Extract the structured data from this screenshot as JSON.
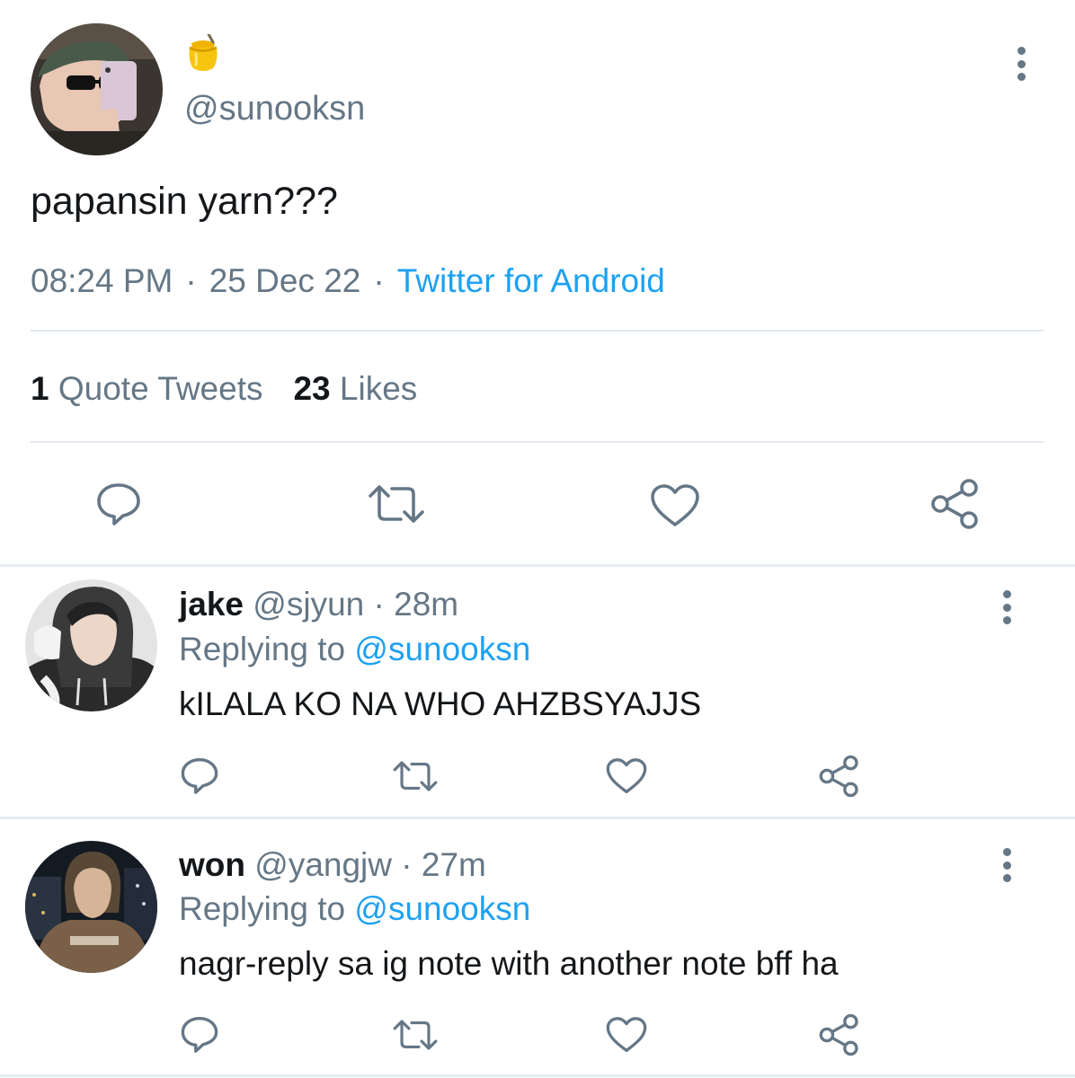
{
  "tweet": {
    "name_emoji": "honey-pot-emoji",
    "handle": "@sunooksn",
    "text": "papansin yarn???",
    "time": "08:24 PM",
    "date": "25 Dec 22",
    "source": "Twitter for Android",
    "separator": "·",
    "quote_count": "1",
    "quote_label": "Quote Tweets",
    "likes_count": "23",
    "likes_label": "Likes"
  },
  "replies": [
    {
      "name": "jake",
      "handle": "@sjyun",
      "separator": "·",
      "time": "28m",
      "replying_label": "Replying to",
      "replying_to": "@sunooksn",
      "text": "kILALA KO NA WHO AHZBSYAJJS"
    },
    {
      "name": "won",
      "handle": "@yangjw",
      "separator": "·",
      "time": "27m",
      "replying_label": "Replying to",
      "replying_to": "@sunooksn",
      "text": "nagr-reply sa ig note with another note bff ha"
    }
  ],
  "icons": {
    "reply": "comment-icon",
    "retweet": "retweet-icon",
    "like": "heart-icon",
    "share": "share-icon",
    "more": "more-vertical-icon"
  },
  "colors": {
    "text": "#14171a",
    "secondary": "#657786",
    "link": "#1da1f2",
    "divider": "#e1e8ed"
  }
}
